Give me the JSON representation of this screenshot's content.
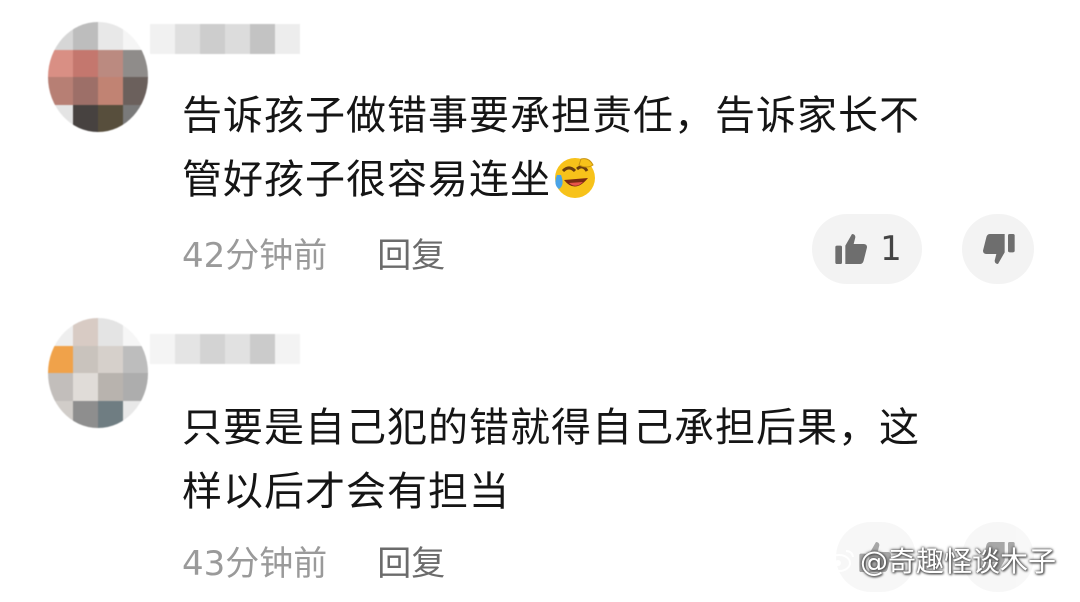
{
  "comments": [
    {
      "text": "告诉孩子做错事要承担责任，告诉家长不\n管好孩子很容易连坐",
      "emoji": "laughing-crying-emoji",
      "time": "42分钟前",
      "reply_label": "回复",
      "like_count": "1"
    },
    {
      "text": "只要是自己犯的错就得自己承担后果，这\n样以后才会有担当",
      "time": "43分钟前",
      "reply_label": "回复",
      "like_count": ""
    }
  ],
  "watermark": {
    "text": "@奇趣怪谈木子"
  },
  "colors": {
    "text": "#151515",
    "meta": "#9a9a9a",
    "pill_bg": "#f3f3f3"
  },
  "icons": [
    "thumbs-up-icon",
    "thumbs-down-icon",
    "weibo-logo-icon"
  ]
}
